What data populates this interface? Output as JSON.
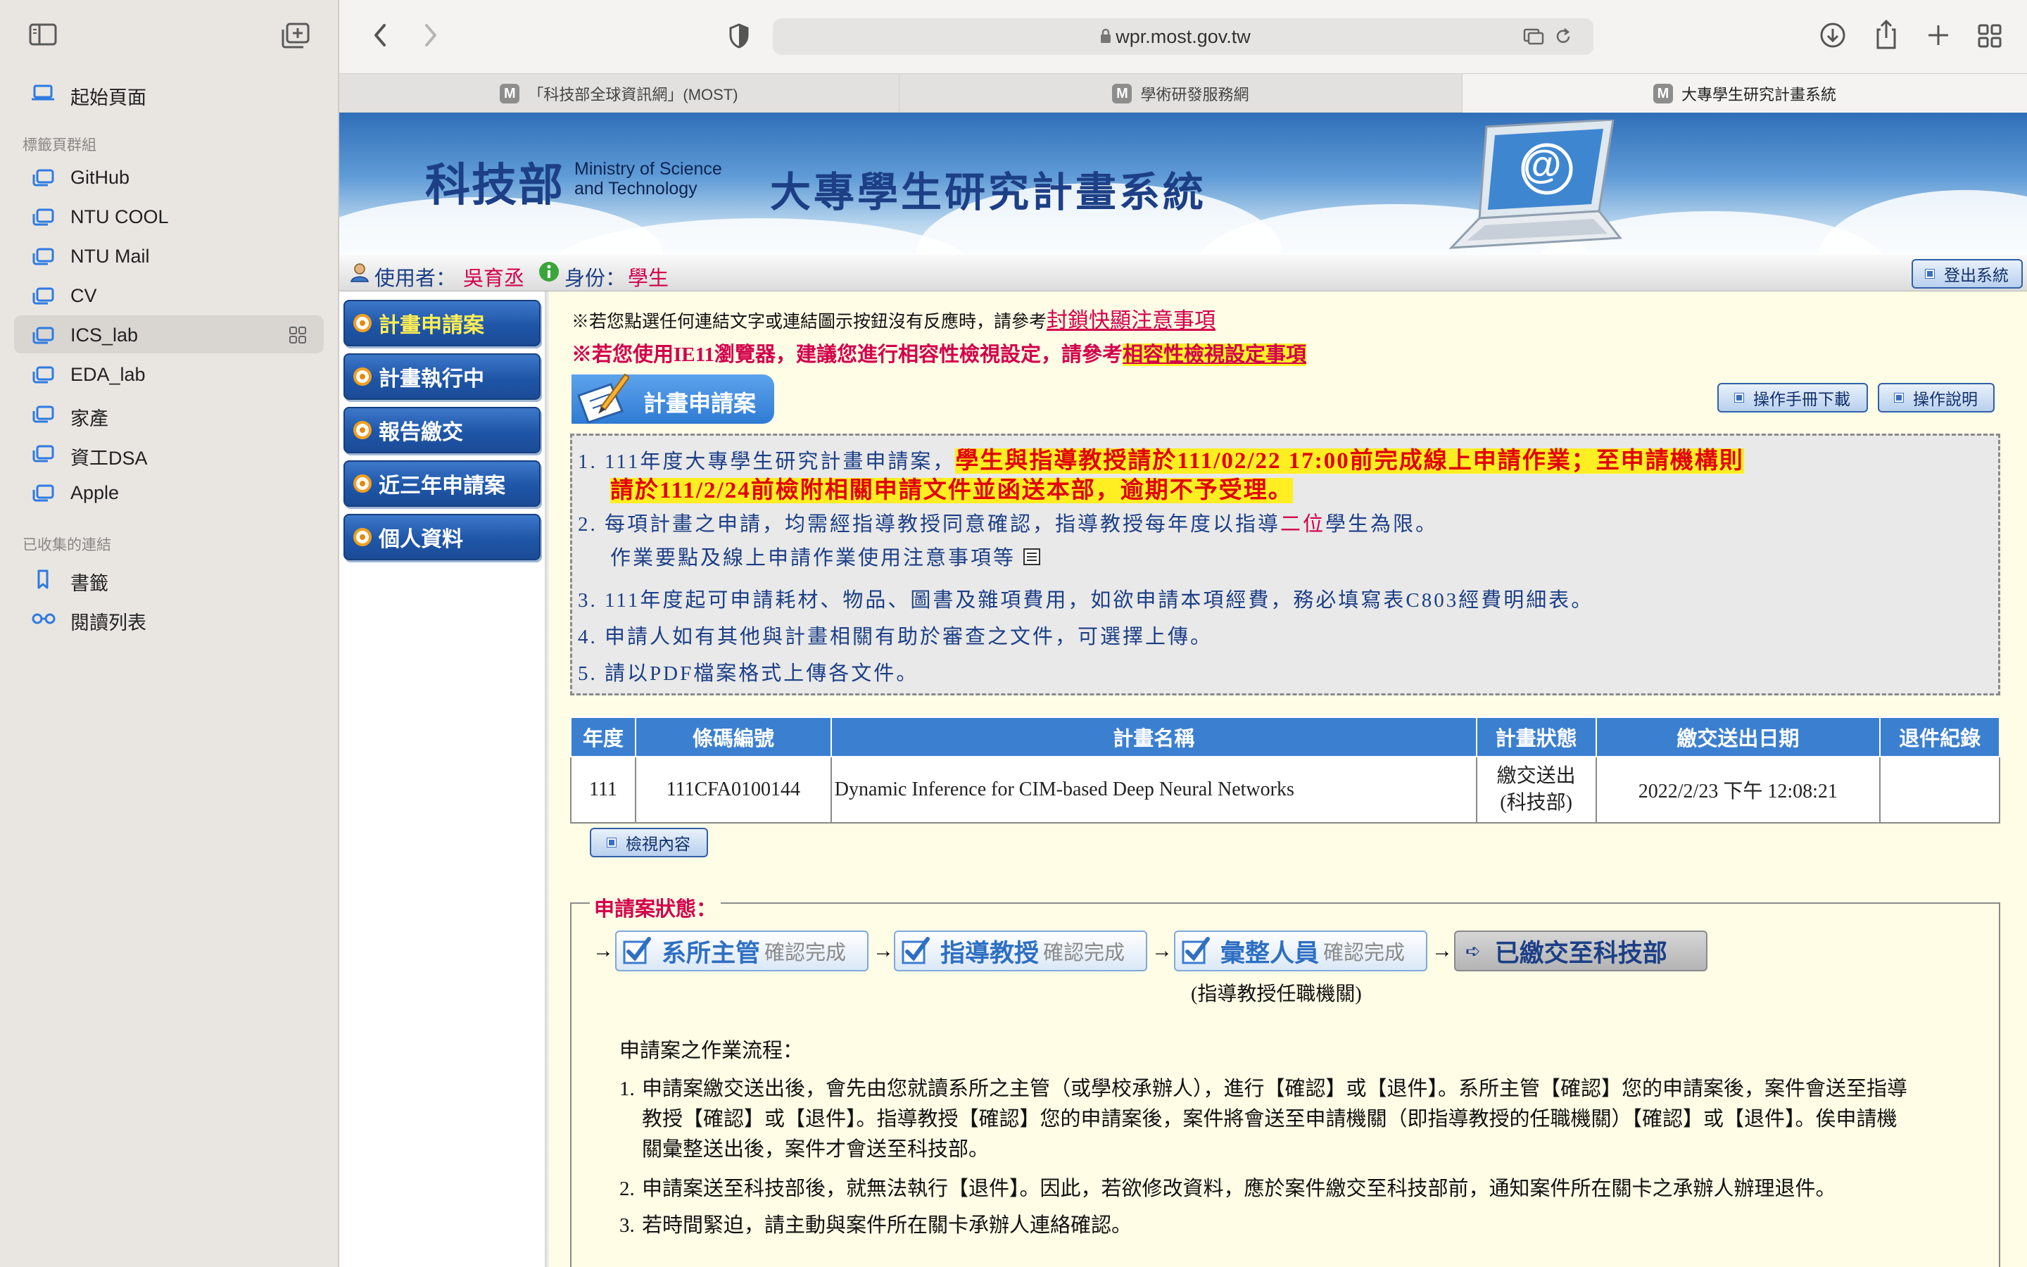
{
  "sidebar": {
    "start_page": "起始頁面",
    "groups_title": "標籤頁群組",
    "groups": [
      "GitHub",
      "NTU COOL",
      "NTU Mail",
      "CV",
      "ICS_lab",
      "EDA_lab",
      "家產",
      "資工DSA",
      "Apple"
    ],
    "selected_group": "ICS_lab",
    "collected_title": "已收集的連結",
    "bookmarks": "書籤",
    "reading_list": "閱讀列表"
  },
  "toolbar": {
    "url": "wpr.most.gov.tw"
  },
  "tabs": [
    {
      "fav": "M",
      "label": "「科技部全球資訊網」(MOST)"
    },
    {
      "fav": "M",
      "label": "學術研發服務網"
    },
    {
      "fav": "M",
      "label": "大專學生研究計畫系統"
    }
  ],
  "banner": {
    "logo_chars": "科技部",
    "logo_en_1": "Ministry of Science",
    "logo_en_2": "and Technology",
    "system_title": "大專學生研究計畫系統",
    "at_symbol": "@"
  },
  "userbar": {
    "user_label": "使用者：",
    "user_name": "吳育丞",
    "role_label": "身份：",
    "role_value": "學生",
    "logout": "登出系統"
  },
  "nav": [
    "計畫申請案",
    "計畫執行中",
    "報告繳交",
    "近三年申請案",
    "個人資料"
  ],
  "notices": {
    "n1_prefix": "※若您點選任何連結文字或連結圖示按鈕沒有反應時，請參考",
    "n1_link": "封鎖快顯注意事項",
    "n2_prefix": "※若您使用IE11瀏覽器，建議您進行相容性檢視設定，請參考",
    "n2_link": "相容性檢視設定事項"
  },
  "section": {
    "title": "計畫申請案",
    "manual_btn": "操作手冊下載",
    "help_btn": "操作說明"
  },
  "announce": {
    "l1a": "1. 111年度大專學生研究計畫申請案，",
    "l1b": "學生與指導教授請於111/02/22 17:00前完成線上申請作業；至申請機構則",
    "l1c": "請於111/2/24前檢附相關申請文件並函送本部，逾期不予受理。",
    "l2a": "2. 每項計畫之申請，均需經指導教授同意確認，指導教授每年度以指導",
    "l2b": "二位",
    "l2c": "學生為限。",
    "l2d": "作業要點及線上申請作業使用注意事項等",
    "l3": "3. 111年度起可申請耗材、物品、圖書及雜項費用，如欲申請本項經費，務必填寫表C803經費明細表。",
    "l4": "4. 申請人如有其他與計畫相關有助於審查之文件，可選擇上傳。",
    "l5": "5. 請以PDF檔案格式上傳各文件。"
  },
  "table": {
    "headers": [
      "年度",
      "條碼編號",
      "計畫名稱",
      "計畫狀態",
      "繳交送出日期",
      "退件紀錄"
    ],
    "row": {
      "year": "111",
      "barcode": "111CFA0100144",
      "name": "Dynamic Inference for CIM-based Deep Neural Networks",
      "status_1": "繳交送出",
      "status_2": "(科技部)",
      "date": "2022/2/23 下午 12:08:21",
      "reject": ""
    },
    "view_btn": "檢視內容"
  },
  "status": {
    "legend": "申請案狀態：",
    "steps": [
      {
        "name": "系所主管",
        "state": "確認完成"
      },
      {
        "name": "指導教授",
        "state": "確認完成"
      },
      {
        "name": "彙整人員",
        "state": "確認完成"
      }
    ],
    "final": "已繳交至科技部",
    "note": "(指導教授任職機關)",
    "arrow": "→",
    "flow_title": "申請案之作業流程：",
    "p1_num": "1.",
    "p1_l1": "申請案繳交送出後，會先由您就讀系所之主管（或學校承辦人），進行【確認】或【退件】。系所主管【確認】您的申請案後，案件會送至指導",
    "p1_l2": "教授【確認】或【退件】。指導教授【確認】您的申請案後，案件將會送至申請機關（即指導教授的任職機關）【確認】或【退件】。俟申請機",
    "p1_l3": "關彙整送出後，案件才會送至科技部。",
    "p2_num": "2.",
    "p2": "申請案送至科技部後，就無法執行【退件】。因此，若欲修改資料，應於案件繳交至科技部前，通知案件所在關卡之承辦人辦理退件。",
    "p3_num": "3.",
    "p3": "若時間緊迫，請主動與案件所在關卡承辦人連絡確認。"
  }
}
